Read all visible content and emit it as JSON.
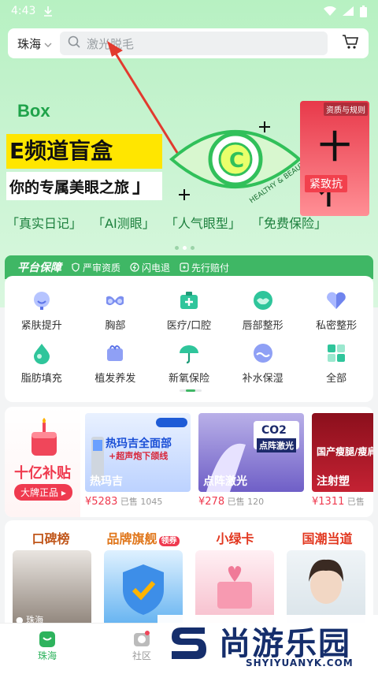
{
  "status_bar": {
    "time": "4:43"
  },
  "header": {
    "city": "珠海",
    "search_placeholder": "激光脱毛"
  },
  "banner": {
    "box_word": "Box",
    "title": "E频道盲盒",
    "subtitle": "你的专属美眼之旅",
    "subtitle_bracket": "」",
    "eye_caption": "HEALTHY & BEAUTY",
    "eye_letter": "C",
    "tags": [
      "「真实日记」",
      "「AI测眼」",
      "「人气眼型」",
      "「免费保险」"
    ],
    "side_card": {
      "qualification": "资质与规则",
      "big_text": "十亻",
      "badge": "紧致抗"
    }
  },
  "guarantee": {
    "title": "平台保障",
    "items": [
      "严审资质",
      "闪电退",
      "先行赔付"
    ]
  },
  "categories": [
    {
      "label": "紧肤提升",
      "icon": "face-lift-icon"
    },
    {
      "label": "胸部",
      "icon": "bra-icon"
    },
    {
      "label": "医疗/口腔",
      "icon": "medical-kit-icon"
    },
    {
      "label": "唇部整形",
      "icon": "lips-icon"
    },
    {
      "label": "私密整形",
      "icon": "heart-icon"
    },
    {
      "label": "脂肪填充",
      "icon": "droplet-icon"
    },
    {
      "label": "植发养发",
      "icon": "hair-icon"
    },
    {
      "label": "新氧保险",
      "icon": "umbrella-icon"
    },
    {
      "label": "补水保湿",
      "icon": "water-icon"
    },
    {
      "label": "全部",
      "icon": "grid-icon"
    }
  ],
  "subsidy": {
    "title": "十亿补贴",
    "badge": "大牌正品",
    "products": [
      {
        "name": "热玛吉",
        "overlay1": "热玛吉全面部",
        "overlay2": "+超声炮下颌线",
        "price": "5283",
        "sold": "已售 1045"
      },
      {
        "name": "点阵激光",
        "overlay1": "CO2",
        "overlay2": "点阵激光",
        "price": "278",
        "sold": "已售 120"
      },
      {
        "name": "注射塑",
        "overlay1": "国产瘦腿/瘦肩",
        "overlay2": "",
        "price": "1311",
        "sold": "已售"
      }
    ],
    "currency": "¥"
  },
  "rank": {
    "headers": [
      "口碑榜",
      "品牌旗舰",
      "小绿卡",
      "国潮当道"
    ],
    "brand_tag": "领券",
    "first_location": "珠海"
  },
  "tabbar": {
    "items": [
      {
        "label": "珠海",
        "active": true
      },
      {
        "label": "社区",
        "active": false
      }
    ]
  },
  "watermark": {
    "title": "尚游乐园",
    "url": "SHYIYUANYK.COM"
  },
  "colors": {
    "accent": "#2eb35d",
    "price": "#ef3a4f",
    "banner_yellow": "#ffe600"
  }
}
